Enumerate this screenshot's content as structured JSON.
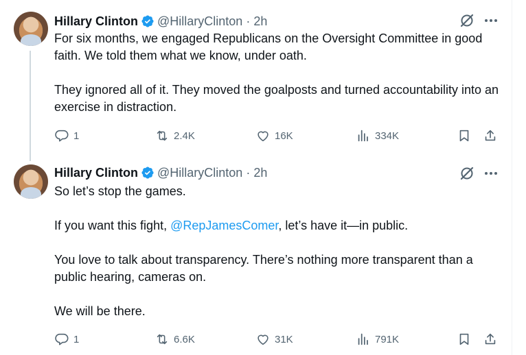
{
  "tweets": [
    {
      "author": {
        "name": "Hillary Clinton",
        "handle": "@HillaryClinton",
        "separator": "·",
        "time": "2h",
        "verified": true,
        "avatar_icon": "profile-photo"
      },
      "paragraphs": [
        "For six months, we engaged Republicans on the Oversight Committee in good faith. We told them what we know, under oath.",
        "They ignored all of it. They moved the goalposts and turned accountability into an exercise in distraction."
      ],
      "actions": {
        "replies": "1",
        "reposts": "2.4K",
        "likes": "16K",
        "views": "334K"
      }
    },
    {
      "author": {
        "name": "Hillary Clinton",
        "handle": "@HillaryClinton",
        "separator": "·",
        "time": "2h",
        "verified": true,
        "avatar_icon": "profile-photo"
      },
      "paragraphs": [
        "So let’s stop the games.",
        "If you want this fight, ",
        "You love to talk about transparency. There’s nothing more transparent than a public hearing, cameras on.",
        "We will be there."
      ],
      "mention": "@RepJamesComer",
      "mention_suffix": ", let’s have it—in public.",
      "actions": {
        "replies": "1",
        "reposts": "6.6K",
        "likes": "31K",
        "views": "791K"
      }
    }
  ],
  "colors": {
    "text": "#0f1419",
    "secondary": "#536471",
    "link": "#1d9bf0",
    "verified": "#1d9bf0"
  },
  "icons": [
    "verified-badge-icon",
    "grok-icon",
    "more-icon",
    "reply-icon",
    "repost-icon",
    "like-icon",
    "views-icon",
    "bookmark-icon",
    "share-icon"
  ]
}
